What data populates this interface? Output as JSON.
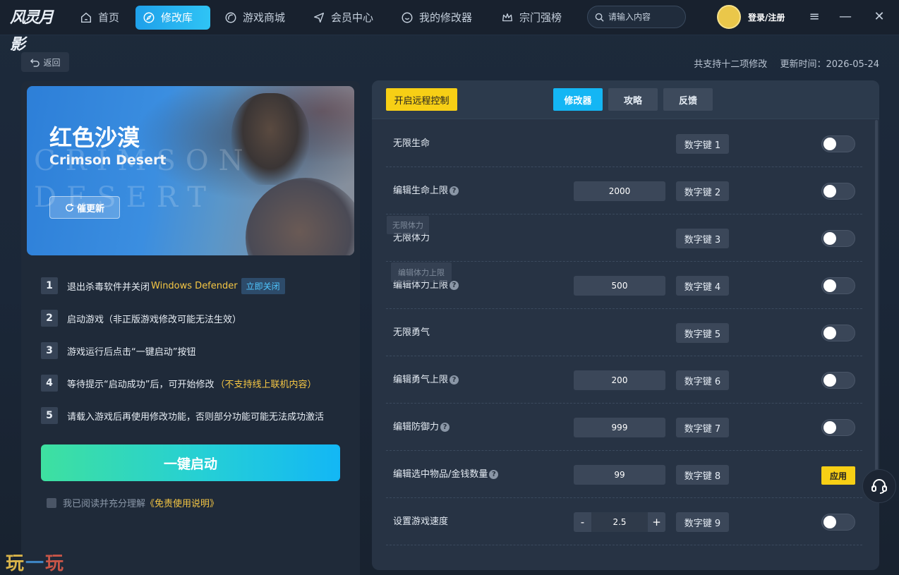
{
  "nav": {
    "logo_text": "风灵月影",
    "items": [
      {
        "label": "首页",
        "icon": "home-icon"
      },
      {
        "label": "修改库",
        "icon": "compass-icon",
        "active": true
      },
      {
        "label": "游戏商城",
        "icon": "store-icon"
      },
      {
        "label": "会员中心",
        "icon": "send-icon"
      },
      {
        "label": "我的修改器",
        "icon": "smile-box-icon"
      },
      {
        "label": "宗门强榜",
        "icon": "crown-icon"
      }
    ],
    "search_placeholder": "请输入内容",
    "login_label": "登录/注册"
  },
  "subheader": {
    "back_label": "返回",
    "support_count": "共支持十二项修改",
    "update_time": "更新时间：2026-05-24"
  },
  "game": {
    "title": "红色沙漠",
    "subtitle": "Crimson Desert",
    "watermark": "CRIMSON DESERT",
    "urge_label": "催更新"
  },
  "steps": [
    {
      "num": "1",
      "text": "退出杀毒软件并关闭",
      "highlight": "Windows Defender",
      "tag": "立即关闭"
    },
    {
      "num": "2",
      "text": "启动游戏（非正版游戏修改可能无法生效）"
    },
    {
      "num": "3",
      "text": "游戏运行后点击“一键启动”按钮"
    },
    {
      "num": "4",
      "text": "等待提示“启动成功”后，可开始修改",
      "highlight": "（不支持线上联机内容）"
    },
    {
      "num": "5",
      "text": "请载入游戏后再使用修改功能，否则部分功能可能无法成功激活"
    }
  ],
  "start_label": "一键启动",
  "agree": {
    "text": "我已阅读并充分理解",
    "link": "《免责使用说明》"
  },
  "brand": {
    "p1": "玩",
    "p2": "一",
    "p3": "玩"
  },
  "trainer": {
    "remote_label": "开启远程控制",
    "tabs": [
      "修改器",
      "攻略",
      "反馈"
    ],
    "rows": [
      {
        "label": "无限生命",
        "hotkey": "数字键 1",
        "control": "toggle"
      },
      {
        "label": "编辑生命上限",
        "help": true,
        "value": "2000",
        "hotkey": "数字键 2",
        "control": "toggle"
      },
      {
        "label": "无限体力",
        "hotkey": "数字键 3",
        "control": "toggle"
      },
      {
        "label": "编辑体力上限",
        "help": true,
        "value": "500",
        "hotkey": "数字键 4",
        "control": "toggle"
      },
      {
        "label": "无限勇气",
        "hotkey": "数字键 5",
        "control": "toggle"
      },
      {
        "label": "编辑勇气上限",
        "help": true,
        "value": "200",
        "hotkey": "数字键 6",
        "control": "toggle"
      },
      {
        "label": "编辑防御力",
        "help": true,
        "value": "999",
        "hotkey": "数字键 7",
        "control": "toggle"
      },
      {
        "label": "编辑选中物品/金钱数量",
        "help": true,
        "value": "99",
        "hotkey": "数字键 8",
        "control": "apply",
        "apply_label": "应用"
      },
      {
        "label": "设置游戏速度",
        "stepper": "2.5",
        "hotkey": "数字键 9",
        "control": "toggle"
      }
    ],
    "ghost_tips": [
      "无限体力",
      "编辑体力上限"
    ]
  },
  "colors": {
    "accent": "#14b6f4",
    "yellow": "#f7cf15",
    "bg": "#1b2738",
    "panel": "#273344"
  }
}
